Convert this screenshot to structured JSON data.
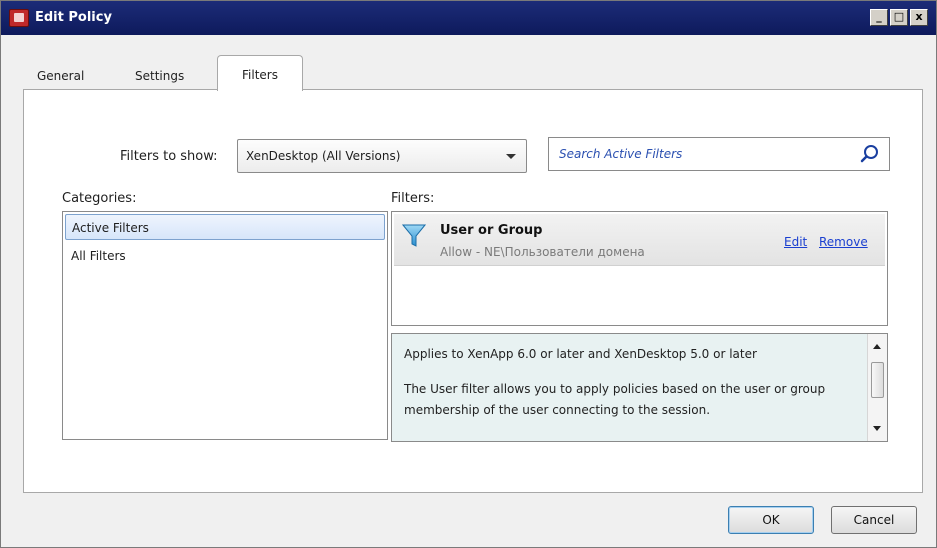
{
  "window": {
    "title": "Edit Policy",
    "controls": [
      "_",
      "□",
      "x"
    ]
  },
  "tabs": [
    {
      "label": "General",
      "active": false
    },
    {
      "label": "Settings",
      "active": false
    },
    {
      "label": "Filters",
      "active": true
    }
  ],
  "filters_to_show": {
    "label": "Filters to show:",
    "selected": "XenDesktop (All Versions)"
  },
  "search": {
    "placeholder": "Search Active Filters"
  },
  "categories": {
    "label": "Categories:",
    "items": [
      {
        "label": "Active Filters",
        "selected": true
      },
      {
        "label": "All Filters",
        "selected": false
      }
    ]
  },
  "filters": {
    "label": "Filters:",
    "items": [
      {
        "name": "User or Group",
        "description": "Allow - NE\\Пользователи домена",
        "edit_label": "Edit",
        "remove_label": "Remove"
      }
    ]
  },
  "description": {
    "lines": [
      "Applies to XenApp 6.0 or later and XenDesktop 5.0 or later",
      "The User filter allows you to apply policies based on the user or group membership of the user connecting to the session."
    ]
  },
  "buttons": {
    "ok": "OK",
    "cancel": "Cancel"
  },
  "colors": {
    "titlebar": "#0e1a5c",
    "link": "#1a3fd0",
    "selection": "#d7e6fa",
    "description_bg": "#e8f2f2"
  }
}
